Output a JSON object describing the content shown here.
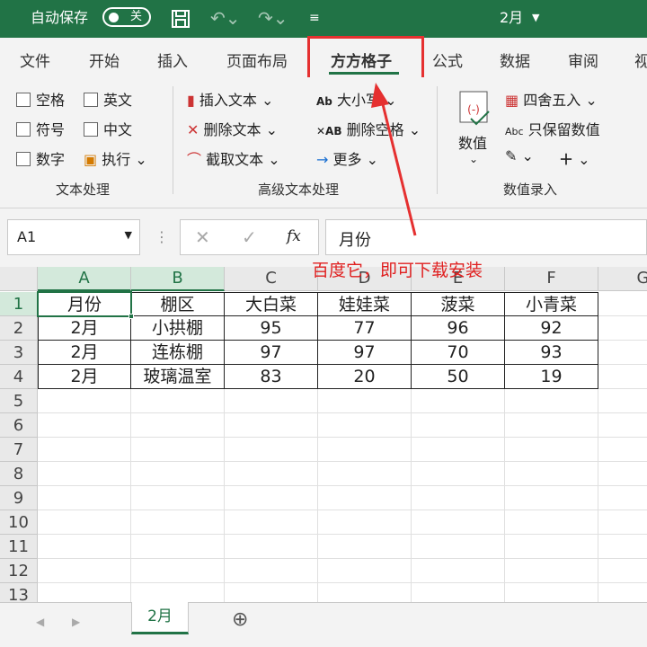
{
  "titlebar": {
    "autosave_label": "自动保存",
    "toggle_state": "关",
    "filename": "2月"
  },
  "tabs": [
    "文件",
    "开始",
    "插入",
    "页面布局",
    "方方格子",
    "公式",
    "数据",
    "审阅",
    "视"
  ],
  "active_tab": "方方格子",
  "ribbon": {
    "text_group": {
      "items": [
        "空格",
        "英文",
        "符号",
        "中文",
        "数字",
        "执行"
      ],
      "label": "文本处理"
    },
    "adv_group": {
      "items": [
        "插入文本",
        "删除文本",
        "截取文本",
        "大小写",
        "删除空格",
        "更多"
      ],
      "label": "高级文本处理"
    },
    "num_group": {
      "value_label": "数值",
      "items": [
        "四舍五入",
        "只保留数值"
      ],
      "label": "数值录入"
    }
  },
  "formula_bar": {
    "name_box": "A1",
    "fx": "fx",
    "value": "月份"
  },
  "annotation": "百度它，即可下载安装",
  "grid": {
    "columns": [
      "A",
      "B",
      "C",
      "D",
      "E",
      "F",
      "G"
    ],
    "rows": [
      "1",
      "2",
      "3",
      "4",
      "5",
      "6",
      "7",
      "8",
      "9",
      "10",
      "11",
      "12",
      "13"
    ],
    "data": [
      [
        "月份",
        "棚区",
        "大白菜",
        "娃娃菜",
        "菠菜",
        "小青菜"
      ],
      [
        "2月",
        "小拱棚",
        "95",
        "77",
        "96",
        "92"
      ],
      [
        "2月",
        "连栋棚",
        "97",
        "97",
        "70",
        "93"
      ],
      [
        "2月",
        "玻璃温室",
        "83",
        "20",
        "50",
        "19"
      ]
    ]
  },
  "sheet_tab": "2月",
  "colors": {
    "accent": "#217346",
    "annotation": "#e02020"
  }
}
